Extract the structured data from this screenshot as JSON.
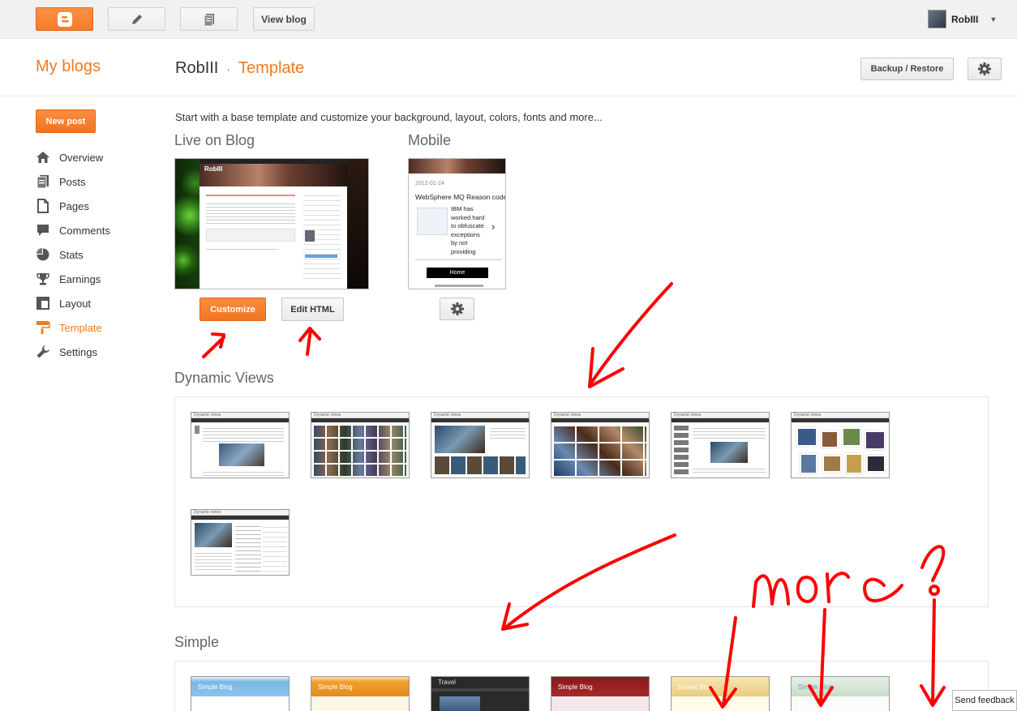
{
  "topbar": {
    "view_blog_label": "View blog",
    "user_name": "RobIII"
  },
  "header": {
    "my_blogs": "My blogs",
    "blog_name": "RobIII",
    "separator": "·",
    "current_page": "Template",
    "backup_label": "Backup / Restore"
  },
  "sidebar": {
    "new_post_label": "New post",
    "items": [
      {
        "label": "Overview",
        "icon": "home-icon"
      },
      {
        "label": "Posts",
        "icon": "posts-icon"
      },
      {
        "label": "Pages",
        "icon": "pages-icon"
      },
      {
        "label": "Comments",
        "icon": "comments-icon"
      },
      {
        "label": "Stats",
        "icon": "stats-icon"
      },
      {
        "label": "Earnings",
        "icon": "trophy-icon"
      },
      {
        "label": "Layout",
        "icon": "layout-icon"
      },
      {
        "label": "Template",
        "icon": "paint-roller-icon",
        "active": true
      },
      {
        "label": "Settings",
        "icon": "wrench-icon"
      }
    ]
  },
  "main": {
    "intro": "Start with a base template and customize your background, layout, colors, fonts and more...",
    "live_title": "Live on Blog",
    "mobile_title": "Mobile",
    "customize_label": "Customize",
    "edit_html_label": "Edit HTML",
    "live_preview": {
      "blog_title": "RobIII"
    },
    "mobile_preview": {
      "date": "2012-01-24",
      "post_title": "WebSphere MQ Reason codes",
      "snippet": "IBM has worked hard to obfuscate exceptions by not providing any specific info in XMSExceptions and...",
      "home_label": "Home"
    },
    "dynamic_title": "Dynamic Views",
    "dynamic_tile_label": "Dynamic views",
    "simple_title": "Simple",
    "simple_tiles": [
      "Simple Blog",
      "Simple Blog",
      "Travel",
      "Simple Blog",
      "Simple Blog",
      "Simple Blog"
    ]
  },
  "annotation": {
    "handwritten_text": "more?"
  },
  "feedback_label": "Send feedback",
  "colors": {
    "accent": "#f07b1f",
    "annotation": "#ff0000"
  }
}
